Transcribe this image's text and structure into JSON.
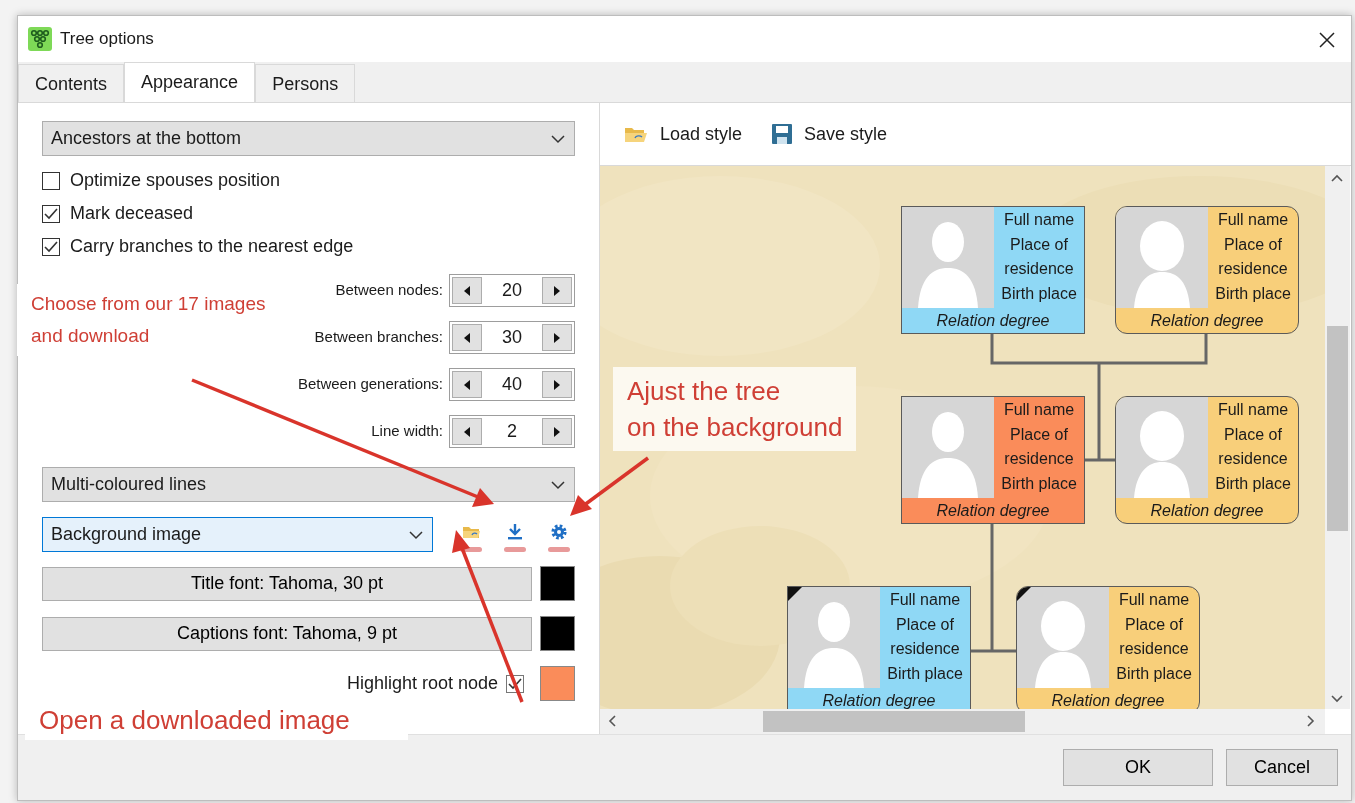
{
  "window": {
    "title": "Tree options"
  },
  "tabs": [
    {
      "label": "Contents",
      "selected": false
    },
    {
      "label": "Appearance",
      "selected": true
    },
    {
      "label": "Persons",
      "selected": false
    }
  ],
  "layout_select": {
    "value": "Ancestors at the bottom"
  },
  "options": [
    {
      "label": "Optimize spouses position",
      "checked": false
    },
    {
      "label": "Mark deceased",
      "checked": true
    },
    {
      "label": "Carry branches to the nearest edge",
      "checked": true
    }
  ],
  "spacings": [
    {
      "label": "Between nodes:",
      "value": "20"
    },
    {
      "label": "Between branches:",
      "value": "30"
    },
    {
      "label": "Between generations:",
      "value": "40"
    },
    {
      "label": "Line width:",
      "value": "2"
    }
  ],
  "lines_select": {
    "value": "Multi-coloured lines"
  },
  "background_select": {
    "value": "Background image"
  },
  "font_buttons": [
    {
      "label": "Title font: Tahoma, 30 pt",
      "color": "#000000"
    },
    {
      "label": "Captions font: Tahoma, 9 pt",
      "color": "#000000"
    }
  ],
  "highlight_root": {
    "label": "Highlight root node",
    "checked": true,
    "color": "#fa8c5a"
  },
  "style_toolbar": [
    {
      "kind": "load",
      "label": "Load style"
    },
    {
      "kind": "save",
      "label": "Save style"
    }
  ],
  "tree_nodes": [
    {
      "kind": "male",
      "color": "#8fd8f5",
      "deceased": false,
      "lines": [
        "Full name",
        "Place of residence",
        "Birth place"
      ],
      "relation": "Relation degree"
    },
    {
      "kind": "female",
      "color": "#f8cf7a",
      "deceased": false,
      "lines": [
        "Full name",
        "Place of residence",
        "Birth place"
      ],
      "relation": "Relation degree"
    },
    {
      "kind": "male",
      "color": "#fa8c5a",
      "deceased": false,
      "lines": [
        "Full name",
        "Place of residence",
        "Birth place"
      ],
      "relation": "Relation degree"
    },
    {
      "kind": "female",
      "color": "#f8cf7a",
      "deceased": false,
      "lines": [
        "Full name",
        "Place of residence",
        "Birth place"
      ],
      "relation": "Relation degree"
    },
    {
      "kind": "male",
      "color": "#8fd8f5",
      "deceased": true,
      "lines": [
        "Full name",
        "Place of residence",
        "Birth place"
      ],
      "relation": "Relation degree"
    },
    {
      "kind": "female",
      "color": "#f8cf7a",
      "deceased": true,
      "lines": [
        "Full name",
        "Place of residence",
        "Birth place"
      ],
      "relation": "Relation degree"
    }
  ],
  "annotations": [
    {
      "text": "Choose from our 17 images\nand download"
    },
    {
      "text": "Ajust the tree\non the background"
    },
    {
      "text": "Open a downloaded image"
    }
  ],
  "buttons": [
    "OK",
    "Cancel"
  ]
}
